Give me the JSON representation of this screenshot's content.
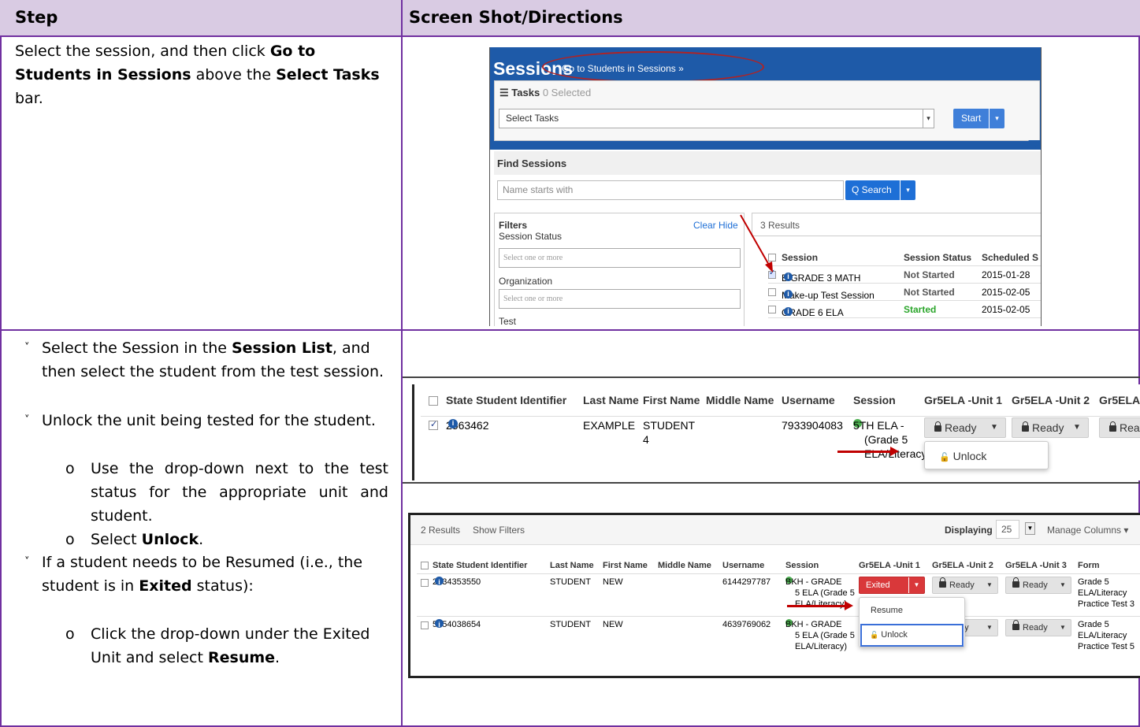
{
  "header": {
    "step": "Step",
    "directions": "Screen Shot/Directions"
  },
  "row1": {
    "text_1": "Select the session, and then click ",
    "bold_1": "Go to Students in Sessions",
    "text_2": " above the ",
    "bold_2": "Select Tasks",
    "text_3": " bar."
  },
  "row2": {
    "b1_text_1": "Select the Session in the ",
    "b1_bold": "Session List",
    "b1_text_2": ", and then select the student from the test session.",
    "b2_text": "Unlock the unit being tested for the student.",
    "s1_text": "Use the drop-down next to the test status for the appropriate unit and student.",
    "s2_text_1": "Select ",
    "s2_bold": "Unlock",
    "s2_text_2": ".",
    "b3_text_1": "If a student needs to be Resumed (i.e., the student is in ",
    "b3_bold": "Exited",
    "b3_text_2": " status):",
    "s3_text_1": "Click the drop-down under the Exited Unit and select ",
    "s3_bold": "Resume",
    "s3_text_2": ".",
    "bullet_marker": "˅",
    "sub_marker": "o"
  },
  "shot1": {
    "title": "Sessions",
    "link": "Go to Students in Sessions »",
    "tasks_label": "Tasks",
    "tasks_count": "0 Selected",
    "select_tasks": "Select Tasks",
    "start": "Start",
    "find_sessions": "Find Sessions",
    "name_placeholder": "Name starts with",
    "search": "Q Search",
    "filters": "Filters",
    "clear_hide": "Clear Hide",
    "session_status": "Session Status",
    "select_one_1": "Select one or more",
    "organization": "Organization",
    "select_one_2": "Select one or more",
    "test": "Test",
    "results": "3 Results",
    "columns": [
      "Session",
      "Session Status",
      "Scheduled S"
    ],
    "rows": [
      {
        "session": "B GRADE 3 MATH",
        "status": "Not Started",
        "date": "2015-01-28"
      },
      {
        "session": "Make-up Test Session",
        "status": "Not Started",
        "date": "2015-02-05"
      },
      {
        "session": "GRADE 6 ELA",
        "status": "Started",
        "date": "2015-02-05"
      }
    ]
  },
  "shot2": {
    "columns": [
      "State Student Identifier",
      "Last Name",
      "First Name",
      "Middle Name",
      "Username",
      "Session",
      "Gr5ELA -Unit 1",
      "Gr5ELA -Unit 2",
      "Gr5ELA"
    ],
    "row": {
      "id": "2563462",
      "last": "EXAMPLE",
      "first": "STUDENT",
      "first_2": "4",
      "username": "7933904083",
      "session_1": "5TH ELA -",
      "session_2": "(Grade 5",
      "session_3": "ELA/Literacy)",
      "unit1": "Ready",
      "unit2": "Ready",
      "unit3": "Rea"
    },
    "menu_unlock": "Unlock"
  },
  "shot3": {
    "results": "2 Results",
    "show_filters": "Show Filters",
    "displaying": "Displaying",
    "display_count": "25",
    "manage_columns": "Manage Columns ▾",
    "columns": [
      "State Student Identifier",
      "Last Name",
      "First Name",
      "Middle Name",
      "Username",
      "Session",
      "Gr5ELA -Unit 1",
      "Gr5ELA -Unit 2",
      "Gr5ELA -Unit 3",
      "Form"
    ],
    "row1": {
      "id": "2534353550",
      "last": "STUDENT",
      "first": "NEW",
      "username": "6144297787",
      "session_1": "BKH - GRADE",
      "session_2": "5 ELA (Grade 5",
      "session_3": "ELA/Literacy)",
      "unit1": "Exited",
      "unit2": "Ready",
      "unit3": "Ready",
      "form_1": "Grade 5",
      "form_2": "ELA/Literacy",
      "form_3": "Practice Test 3"
    },
    "row2": {
      "id": "5654038654",
      "last": "STUDENT",
      "first": "NEW",
      "username": "4639769062",
      "session_1": "BKH - GRADE",
      "session_2": "5 ELA (Grade 5",
      "session_3": "ELA/Literacy)",
      "unit2_partial": "dy",
      "unit3": "Ready",
      "form_1": "Grade 5",
      "form_2": "ELA/Literacy",
      "form_3": "Practice Test 5"
    },
    "menu_resume": "Resume",
    "menu_unlock": "Unlock"
  },
  "colors": {
    "border": "#7030a0",
    "header_bg": "#d9cbe3",
    "banner": "#1e5aa8",
    "arrow": "#c00000",
    "exited": "#d9383a"
  }
}
